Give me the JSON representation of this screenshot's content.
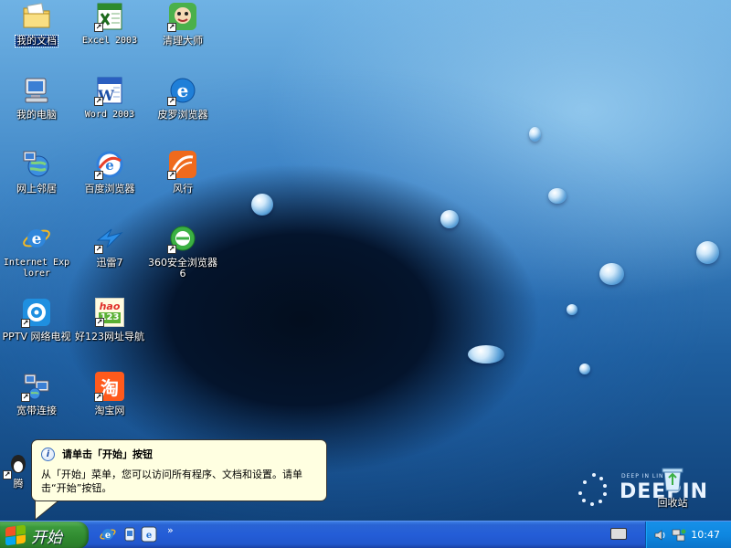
{
  "desktop": {
    "icons": [
      {
        "id": "my-documents",
        "label": "我的文档",
        "icon": "folder-documents-icon",
        "selected": true,
        "shortcut": false
      },
      {
        "id": "excel-2003",
        "label": "Excel 2003",
        "icon": "excel-icon",
        "shortcut": true,
        "mono": true
      },
      {
        "id": "cleanup-master",
        "label": "清理大师",
        "icon": "cleanup-master-icon",
        "shortcut": true
      },
      {
        "id": "my-computer",
        "label": "我的电脑",
        "icon": "computer-icon",
        "shortcut": false
      },
      {
        "id": "word-2003",
        "label": "Word 2003",
        "icon": "word-icon",
        "shortcut": true,
        "mono": true
      },
      {
        "id": "piluo-browser",
        "label": "皮罗浏览器",
        "icon": "browser-e-icon",
        "shortcut": true
      },
      {
        "id": "network-places",
        "label": "网上邻居",
        "icon": "network-places-icon",
        "shortcut": false
      },
      {
        "id": "baidu-browser",
        "label": "百度浏览器",
        "icon": "baidu-browser-icon",
        "shortcut": true
      },
      {
        "id": "fengxing",
        "label": "风行",
        "icon": "fengxing-icon",
        "shortcut": true
      },
      {
        "id": "internet-explorer",
        "label": "Internet Explorer",
        "icon": "internet-explorer-icon",
        "shortcut": false,
        "mono": true
      },
      {
        "id": "xunlei",
        "label": "迅雷7",
        "icon": "xunlei-icon",
        "shortcut": true
      },
      {
        "id": "360-browser",
        "label": "360安全浏览器6",
        "icon": "360-browser-icon",
        "shortcut": true
      },
      {
        "id": "pptv",
        "label": "PPTV 网络电视",
        "icon": "pptv-icon",
        "shortcut": true
      },
      {
        "id": "hao123",
        "label": "好123网址导航",
        "icon": "hao123-icon",
        "shortcut": true
      },
      {
        "id": "broadband",
        "label": "宽带连接",
        "icon": "broadband-connection-icon",
        "shortcut": true
      },
      {
        "id": "taobao",
        "label": "淘宝网",
        "icon": "taobao-icon",
        "shortcut": true
      },
      {
        "id": "tencent",
        "label": "腾",
        "icon": "tencent-icon",
        "shortcut": true
      },
      {
        "id": "recycle-bin",
        "label": "回收站",
        "icon": "recycle-bin-icon",
        "shortcut": false
      }
    ],
    "hao_badge_top": "hao",
    "hao_badge_bottom": "123",
    "taobao_glyph": "淘"
  },
  "balloon": {
    "icon": "info-icon",
    "icon_glyph": "i",
    "title": "请单击「开始」按钮",
    "body": "从「开始」菜单，您可以访问所有程序、文档和设置。请单击“开始”按钮。"
  },
  "branding": {
    "small_text": "DEEP IN LINUX",
    "big_text": "DEEPIN"
  },
  "taskbar": {
    "start_label": "开始",
    "quick_launch": [
      "internet-explorer-icon",
      "show-desktop-icon",
      "media-icon"
    ],
    "chevron": "»",
    "tray_icons": [
      "speaker-icon",
      "network-icon"
    ],
    "clock": "10:47"
  },
  "colors": {
    "taskbar_blue": "#245dd7",
    "start_green": "#3c9a3c",
    "balloon_bg": "#ffffe1",
    "tray_blue": "#0e87e0"
  }
}
